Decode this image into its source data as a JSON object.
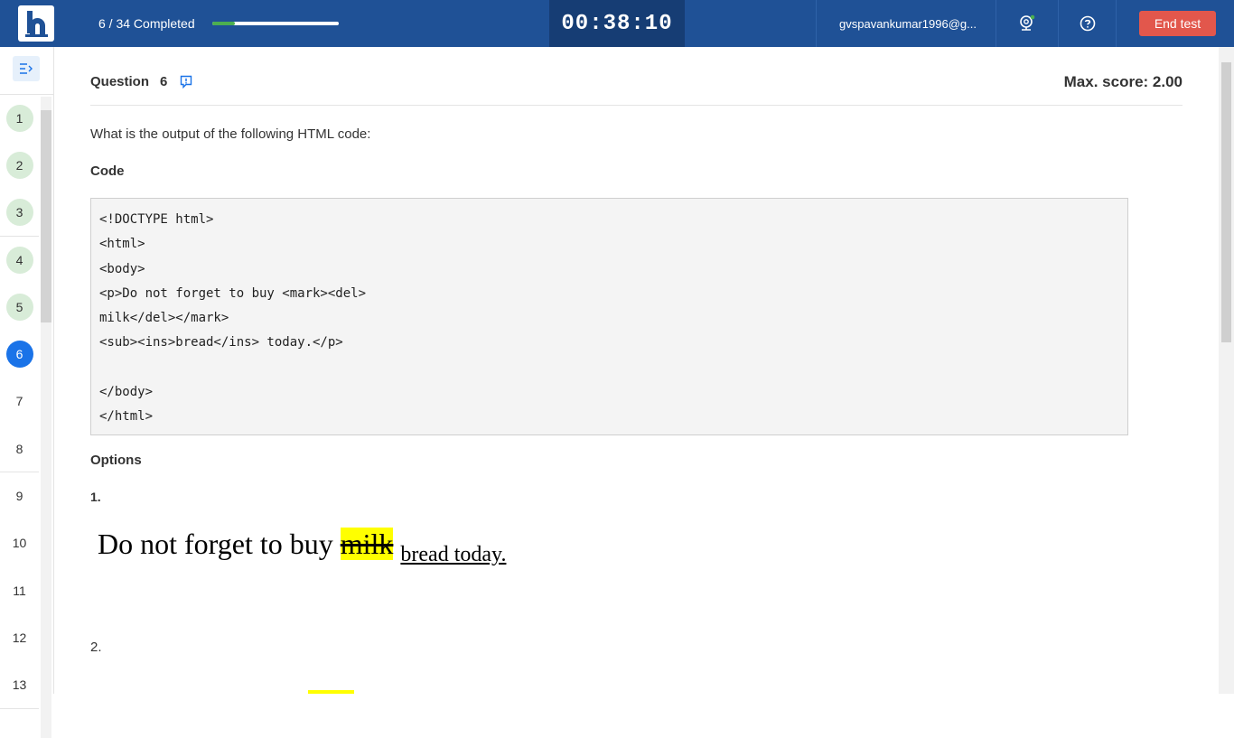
{
  "header": {
    "progress_text": "6 / 34 Completed",
    "progress_fraction": 0.18,
    "timer": "00:38:10",
    "user": "gvspavankumar1996@g...",
    "end_test_label": "End test",
    "colors": {
      "bar": "#1f5196",
      "timer_bg": "#163d74",
      "end_button": "#e2574c",
      "progress": "#4caf50"
    }
  },
  "sidebar": {
    "toggle_icon": "sidebar-toggle-icon",
    "questions": [
      {
        "label": "1",
        "state": "done"
      },
      {
        "label": "2",
        "state": "done"
      },
      {
        "label": "3",
        "state": "done"
      },
      {
        "label": "4",
        "state": "done"
      },
      {
        "label": "5",
        "state": "done"
      },
      {
        "label": "6",
        "state": "current"
      },
      {
        "label": "7",
        "state": "none"
      },
      {
        "label": "8",
        "state": "none"
      },
      {
        "label": "9",
        "state": "none"
      },
      {
        "label": "10",
        "state": "none"
      },
      {
        "label": "11",
        "state": "none"
      },
      {
        "label": "12",
        "state": "none"
      },
      {
        "label": "13",
        "state": "none"
      }
    ]
  },
  "question": {
    "title": "Question",
    "number": "6",
    "max_score": "Max. score: 2.00",
    "text": "What is the output of the following HTML code:",
    "code_label": "Code",
    "code_lines": [
      "<!DOCTYPE html>",
      "<html>",
      "<body>",
      "<p>Do not forget to buy <mark><del>",
      "milk</del></mark>",
      "<sub><ins>bread</ins> today.</p>",
      "",
      "</body>",
      "</html>"
    ],
    "options_label": "Options",
    "option1": {
      "label": "1.",
      "prefix": "Do not forget to buy ",
      "marked": "milk",
      "sub_text": "bread today."
    },
    "option2": {
      "label": "2."
    }
  }
}
